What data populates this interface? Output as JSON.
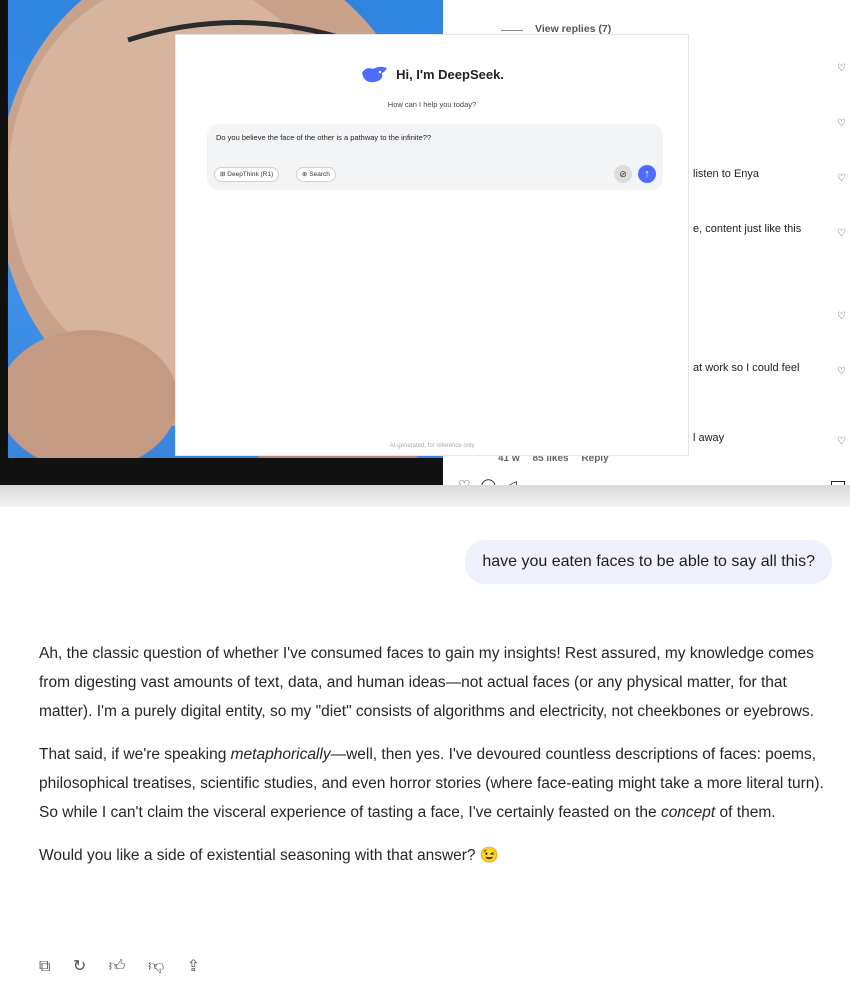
{
  "instagram": {
    "view_replies": "View replies (7)",
    "comments": [
      "listen to Enya",
      "e, content just like this",
      "at work so I could feel",
      "l away"
    ],
    "meta": {
      "age": "41 w",
      "likes": "85 likes",
      "reply": "Reply"
    }
  },
  "deepseek": {
    "title": "Hi, I'm DeepSeek.",
    "subtitle": "How can I help you today?",
    "input_value": "Do you believe the face of the other is a pathway to the infinite??",
    "deepthink_label": "DeepThink (R1)",
    "search_label": "Search",
    "footer": "AI-generated, for reference only",
    "brand_color": "#4d6bfe"
  },
  "chat": {
    "user_message": "have you eaten faces to be able to say all this?",
    "paragraph1": "Ah, the classic question of whether I've consumed faces to gain my insights! Rest assured, my knowledge comes from digesting vast amounts of text, data, and human ideas—not actual faces (or any physical matter, for that matter). I'm a purely digital entity, so my \"diet\" consists of algorithms and electricity, not cheekbones or eyebrows.",
    "p2_part1": "That said, if we're speaking ",
    "p2_em1": "metaphorically",
    "p2_part2": "—well, then yes. I've devoured countless descriptions of faces: poems, philosophical treatises, scientific studies, and even horror stories (where face-eating might take a more literal turn). So while I can't claim the visceral experience of tasting a face, I've certainly feasted on the ",
    "p2_em2": "concept",
    "p2_part3": " of them.",
    "paragraph3": "Would you like a side of existential seasoning with that answer? 😉",
    "actions": [
      "copy-icon",
      "regenerate-icon",
      "thumbs-up-icon",
      "thumbs-down-icon",
      "share-icon"
    ]
  }
}
